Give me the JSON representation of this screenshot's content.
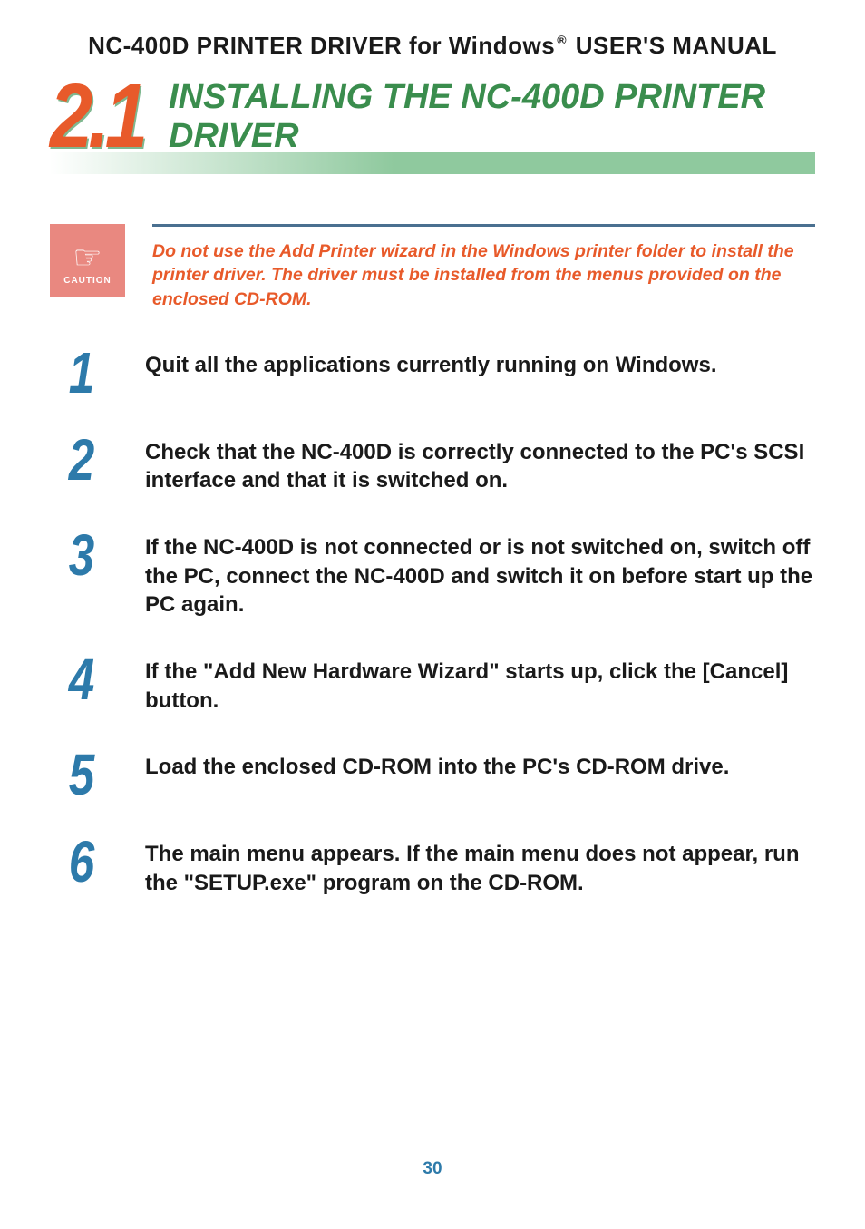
{
  "header": {
    "prefix": "NC-400D PRINTER DRIVER for Windows",
    "registered": "®",
    "suffix": " USER'S MANUAL"
  },
  "section": {
    "number": "2.1",
    "title": "INSTALLING THE NC-400D PRINTER DRIVER"
  },
  "caution": {
    "label": "CAUTION",
    "text": "Do not use the Add Printer wizard in the Windows printer folder to install the printer driver. The driver must be installed from the menus provided on the enclosed CD-ROM."
  },
  "steps": [
    {
      "num": "1",
      "text": "Quit all the applications currently running on Windows."
    },
    {
      "num": "2",
      "text": "Check that the NC-400D is correctly connected to the PC's SCSI interface and that it is switched on."
    },
    {
      "num": "3",
      "text": "If the NC-400D is not connected or is not switched on, switch off the PC, connect the NC-400D and switch it on before start up the PC again."
    },
    {
      "num": "4",
      "text": "If the \"Add New Hardware Wizard\" starts up, click the [Cancel] button."
    },
    {
      "num": "5",
      "text": "Load the enclosed CD-ROM into the PC's CD-ROM drive."
    },
    {
      "num": "6",
      "text": "The main menu appears. If the main menu does not appear, run the \"SETUP.exe\" program on the CD-ROM."
    }
  ],
  "pageNumber": "30"
}
